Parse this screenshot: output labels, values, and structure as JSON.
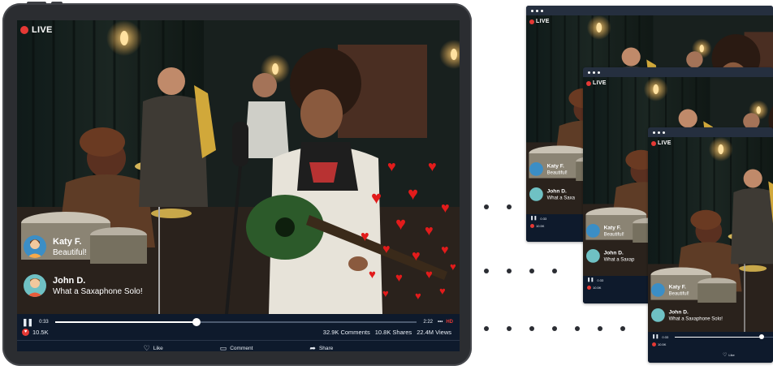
{
  "main_player": {
    "live_label": "LIVE",
    "comments": [
      {
        "name": "Katy F.",
        "message": "Beautiful!",
        "avatar": "woman-avatar"
      },
      {
        "name": "John D.",
        "message": "What a Saxaphone Solo!",
        "avatar": "man-avatar"
      }
    ],
    "controls": {
      "pause_icon": "pause-icon",
      "current_time": "0:33",
      "total_time": "2:22",
      "more_label": "•••",
      "quality_label": "HD",
      "progress": 0.39
    },
    "stats": {
      "likes": "10.5K",
      "comments": "32.9K Comments",
      "shares": "10.8K Shares",
      "views": "22.4M Views"
    },
    "actions": [
      {
        "label": "Like",
        "icon": "heart-outline-icon"
      },
      {
        "label": "Comment",
        "icon": "comment-icon"
      },
      {
        "label": "Share",
        "icon": "share-arrow-icon"
      }
    ]
  },
  "windows": [
    {
      "live_label": "LIVE",
      "comments": [
        {
          "name": "Katy F.",
          "message": "Beautiful!"
        },
        {
          "name": "John D.",
          "message": "What a Saxa"
        }
      ],
      "current_time": "0:33",
      "likes": "10.5K"
    },
    {
      "live_label": "LIVE",
      "comments": [
        {
          "name": "Katy F.",
          "message": "Beautiful!"
        },
        {
          "name": "John D.",
          "message": "What a Saxap"
        }
      ],
      "current_time": "0:33",
      "likes": "10.5K"
    },
    {
      "live_label": "LIVE",
      "comments": [
        {
          "name": "Katy F.",
          "message": "Beautiful!"
        },
        {
          "name": "John D.",
          "message": "What a Saxaphone Solo!"
        }
      ],
      "current_time": "0:33",
      "likes": "10.5K",
      "like_label": "Like"
    }
  ],
  "colors": {
    "live_red": "#e53935",
    "heart_red": "#e21b1b",
    "player_bar": "#0e1a2c",
    "device_frame": "#2b2d31"
  }
}
